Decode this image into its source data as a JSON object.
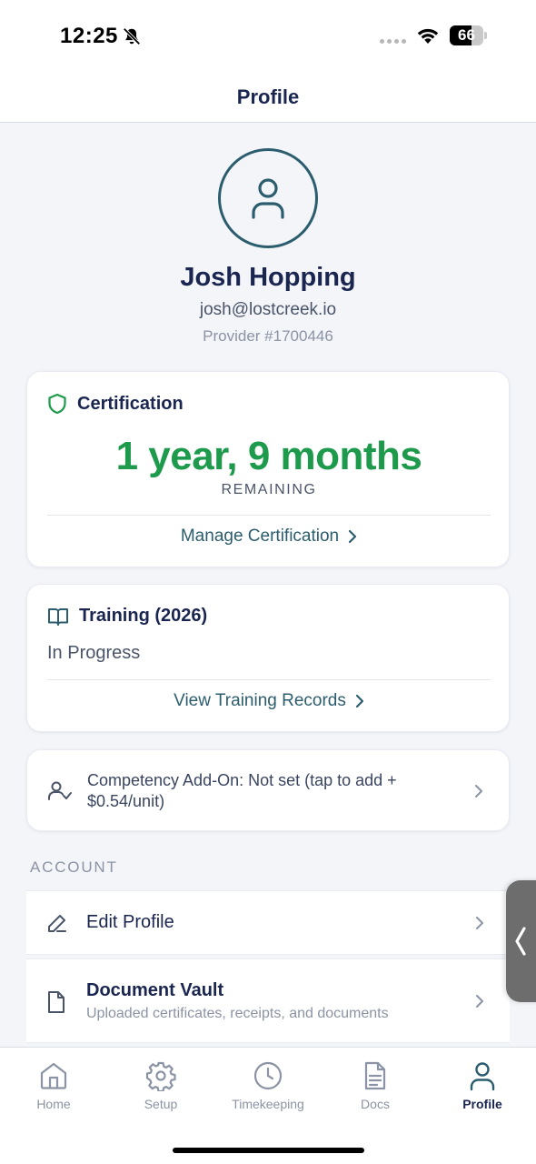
{
  "status_bar": {
    "time": "12:25",
    "battery_level": "66",
    "battery_fraction": 0.66
  },
  "header": {
    "title": "Profile"
  },
  "profile": {
    "name": "Josh Hopping",
    "email": "josh@lostcreek.io",
    "provider": "Provider #1700446"
  },
  "certification": {
    "title": "Certification",
    "value": "1 year, 9 months",
    "subtitle": "REMAINING",
    "link_label": "Manage Certification"
  },
  "training": {
    "title": "Training (2026)",
    "status": "In Progress",
    "link_label": "View Training Records"
  },
  "competency": {
    "label": "Competency Add-On: Not set (tap to add + $0.54/unit)"
  },
  "account": {
    "section_label": "ACCOUNT",
    "items": [
      {
        "title": "Edit Profile",
        "icon": "pencil-icon"
      },
      {
        "title": "Document Vault",
        "subtitle": "Uploaded certificates, receipts, and documents",
        "icon": "document-icon"
      }
    ]
  },
  "tabs": [
    {
      "label": "Home",
      "icon": "home-icon",
      "active": false
    },
    {
      "label": "Setup",
      "icon": "gear-icon",
      "active": false
    },
    {
      "label": "Timekeeping",
      "icon": "clock-icon",
      "active": false
    },
    {
      "label": "Docs",
      "icon": "docs-icon",
      "active": false
    },
    {
      "label": "Profile",
      "icon": "user-icon",
      "active": true
    }
  ],
  "colors": {
    "primary_navy": "#1a2550",
    "teal": "#2c5d6e",
    "success_green": "#1d9a4b",
    "muted_gray": "#8b93a4",
    "background": "#f3f5f9"
  }
}
